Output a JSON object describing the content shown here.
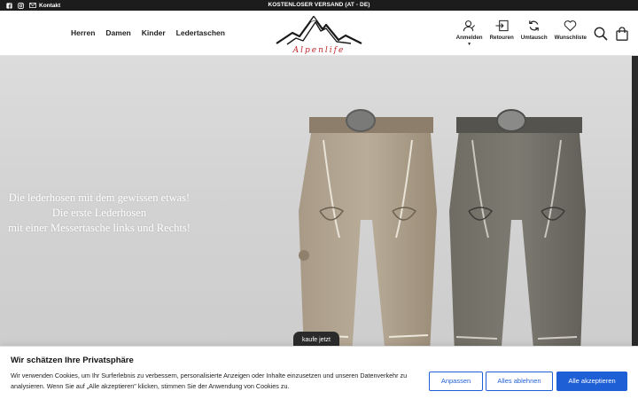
{
  "topbar": {
    "contact_label": "Kontakt",
    "promo": "KOSTENLOSER VERSAND (AT - DE)"
  },
  "nav": {
    "items": [
      "Herren",
      "Damen",
      "Kinder",
      "Ledertaschen"
    ]
  },
  "logo": {
    "text": "Alpenlife"
  },
  "actions": {
    "login": "Anmelden",
    "returns": "Retouren",
    "exchange": "Umtausch",
    "wishlist": "Wunschliste"
  },
  "hero": {
    "line1": "Die lederhosen mit dem gewissen etwas!",
    "line2": "Die erste Lederhosen",
    "line3": "mit einer Messertasche links und Rechts!",
    "cta": "kaufe jetzt"
  },
  "cookie": {
    "title": "Wir schätzen Ihre Privatsphäre",
    "text": "Wir verwenden Cookies, um Ihr Surferlebnis zu verbessern, personalisierte Anzeigen oder Inhalte einzusetzen und unseren Datenverkehr zu analysieren. Wenn Sie auf „Alle akzeptieren\" klicken, stimmen Sie der Anwendung von Cookies zu.",
    "customize": "Anpassen",
    "reject": "Alles ablehnen",
    "accept": "Alle akzeptieren"
  },
  "colors": {
    "topbar_bg": "#1c1c1c",
    "accent_blue": "#1f5fd6",
    "logo_red": "#c0272d",
    "hero_bg": "#d3d3d3"
  }
}
